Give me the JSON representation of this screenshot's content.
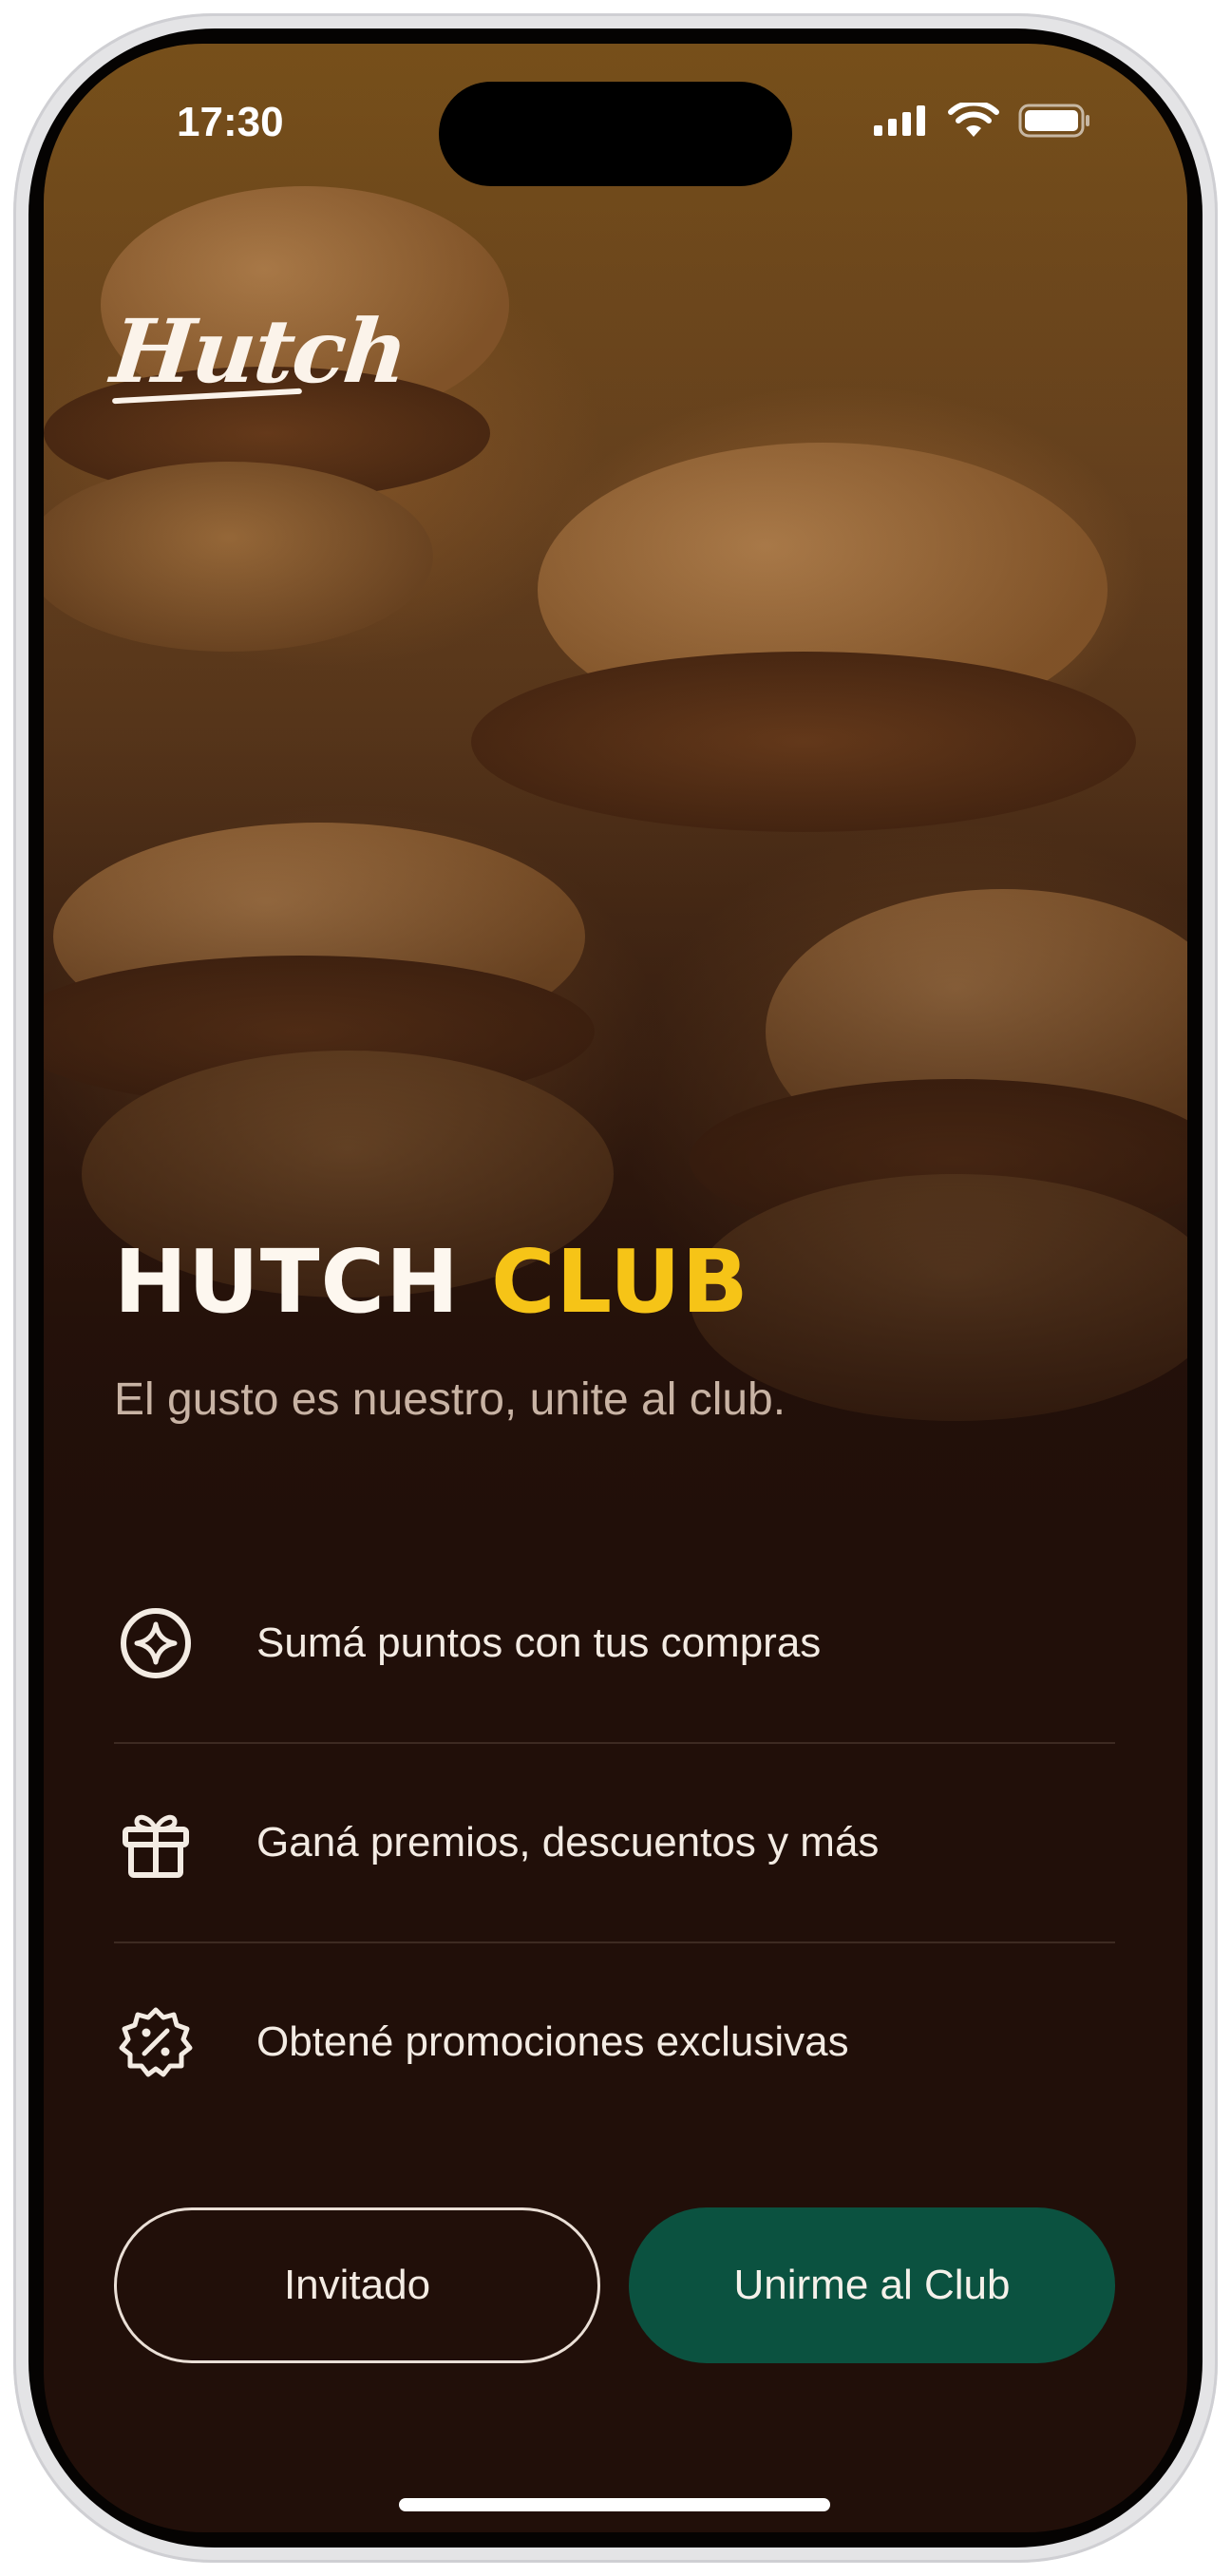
{
  "status_bar": {
    "time": "17:30"
  },
  "brand": {
    "logo_text": "Hutch"
  },
  "hero": {
    "title_main": "HUTCH",
    "title_accent": "CLUB",
    "subtitle": "El gusto es nuestro, unite al club."
  },
  "benefits": [
    {
      "icon": "sparkle-circle-icon",
      "label": "Sumá puntos con tus compras"
    },
    {
      "icon": "gift-icon",
      "label": "Ganá premios, descuentos y más"
    },
    {
      "icon": "discount-badge-icon",
      "label": "Obtené promociones exclusivas"
    }
  ],
  "actions": {
    "guest_label": "Invitado",
    "join_label": "Unirme al Club"
  },
  "colors": {
    "background": "#210f09",
    "accent_yellow": "#f6c417",
    "primary_green": "#0b5240",
    "text_light": "#f3ebe3"
  }
}
